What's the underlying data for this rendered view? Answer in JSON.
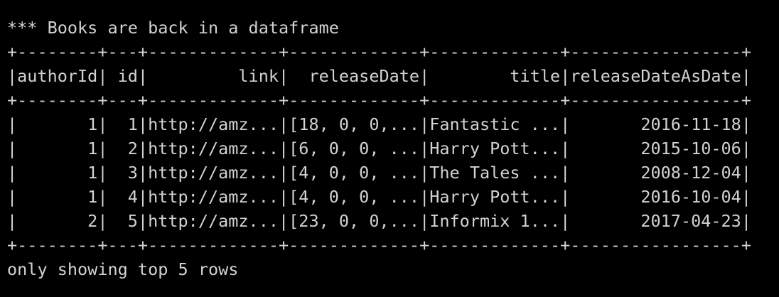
{
  "terminal": {
    "heading": "*** Books are back in a dataframe",
    "border_top": "+--------+---+-------------+-------------+-------------+-----------------+",
    "header_row": "|authorId| id|         link|  releaseDate|        title|releaseDateAsDate|",
    "border_mid": "+--------+---+-------------+-------------+-------------+-----------------+",
    "rows": [
      "|       1|  1|http://amz...|[18, 0, 0,...|Fantastic ...|       2016-11-18|",
      "|       1|  2|http://amz...|[6, 0, 0, ...|Harry Pott...|       2015-10-06|",
      "|       1|  3|http://amz...|[4, 0, 0, ...|The Tales ...|       2008-12-04|",
      "|       1|  4|http://amz...|[4, 0, 0, ...|Harry Pott...|       2016-10-04|",
      "|       2|  5|http://amz...|[23, 0, 0,...|Informix 1...|       2017-04-23|"
    ],
    "border_bottom": "+--------+---+-------------+-------------+-------------+-----------------+",
    "footer": "only showing top 5 rows"
  }
}
